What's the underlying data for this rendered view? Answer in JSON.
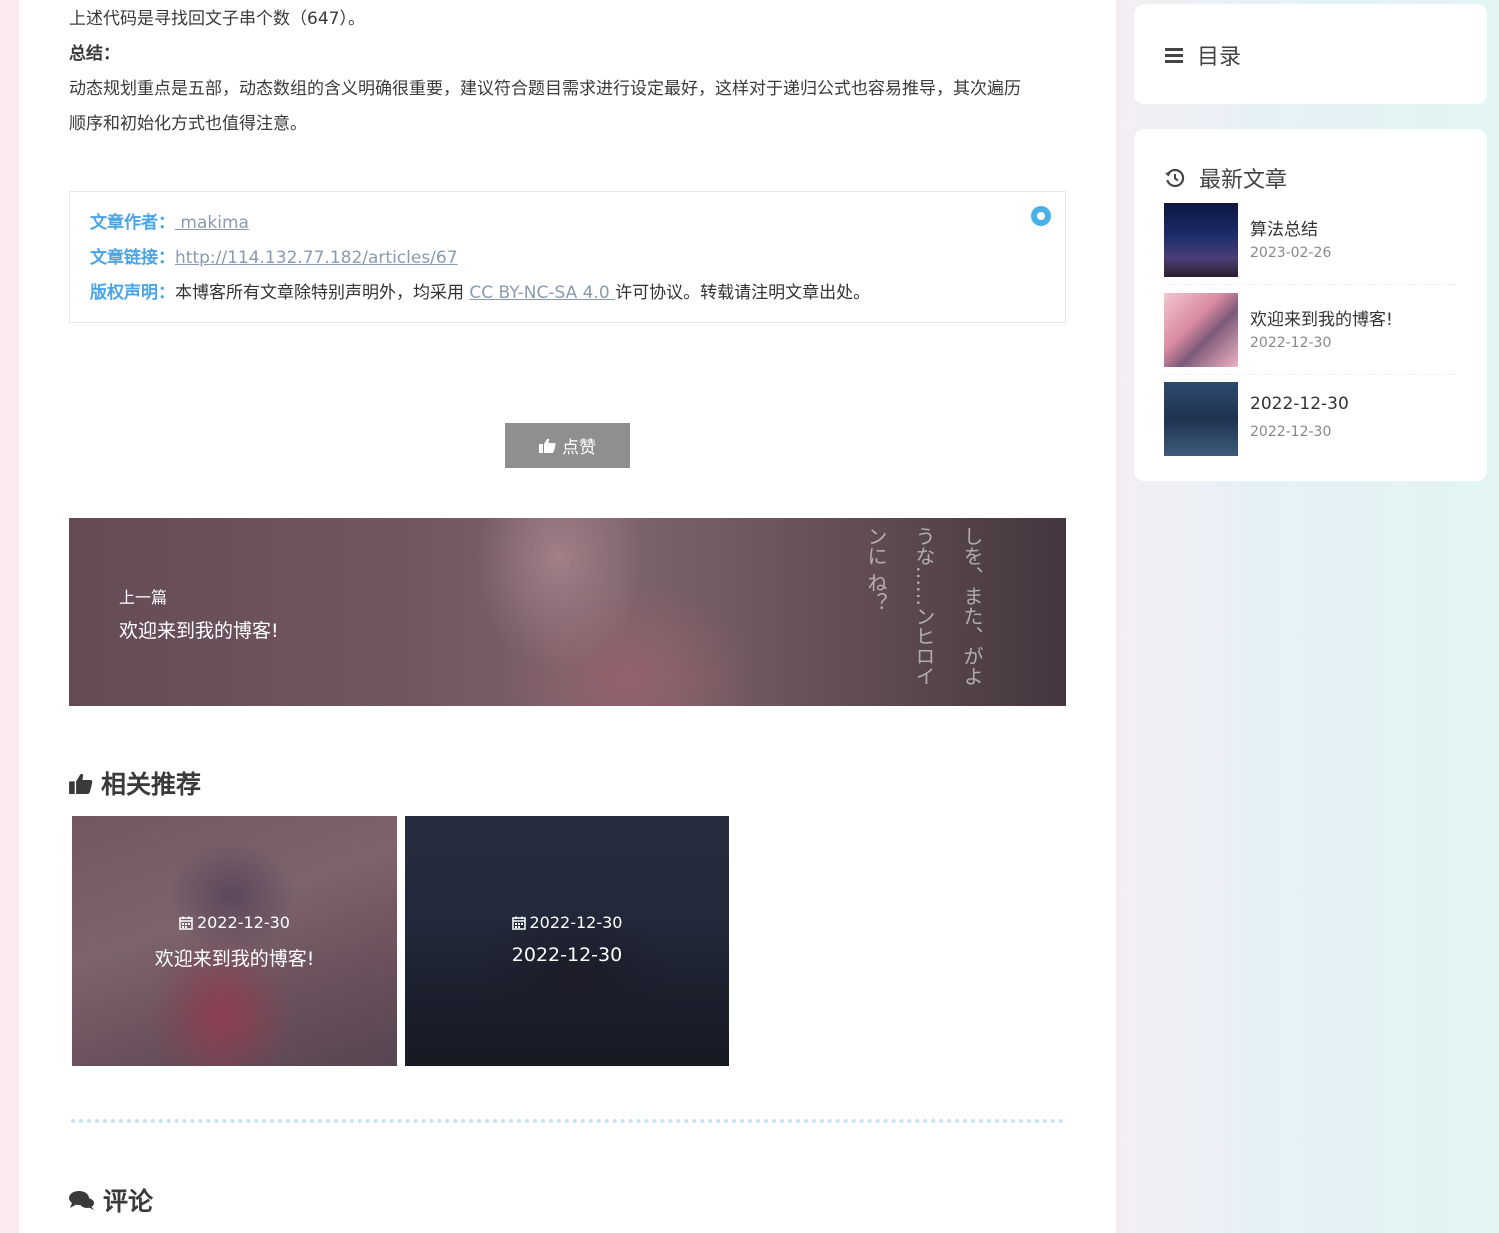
{
  "article": {
    "para1": "上述代码是寻找回文子串个数（647）。",
    "para2": "总结：",
    "para3_line1": "动态规划重点是五部，动态数组的含义明确很重要，建议符合题目需求进行设定最好，这样对于递归公式也容易推导，其次遍历",
    "para3_line2": "顺序和初始化方式也值得注意。"
  },
  "copyright": {
    "author_key": "文章作者：",
    "author_value": " makima",
    "link_key": "文章链接：",
    "link_value": "http://114.132.77.182/articles/67",
    "license_key": "版权声明：",
    "license_prefix": "本博客所有文章除特别声明外，均采用 ",
    "license_link": "CC BY-NC-SA 4.0 ",
    "license_suffix": "许可协议。转载请注明文章出处。"
  },
  "like_button": {
    "label": "点赞"
  },
  "prev_post": {
    "sub": "上一篇",
    "title": "欢迎来到我的博客!",
    "jp_text": "しを、また、がような……ンヒロインに ね？"
  },
  "related": {
    "heading": "相关推荐",
    "items": [
      {
        "date": "2022-12-30",
        "title": "欢迎来到我的博客!"
      },
      {
        "date": "2022-12-30",
        "title": "2022-12-30"
      }
    ]
  },
  "comments": {
    "heading": "评论"
  },
  "sidebar": {
    "toc_title": "目录",
    "latest_title": "最新文章",
    "latest": [
      {
        "title": "算法总结",
        "date": "2023-02-26"
      },
      {
        "title": "欢迎来到我的博客!",
        "date": "2022-12-30"
      },
      {
        "title": "2022-12-30",
        "date": "2022-12-30"
      }
    ]
  },
  "colors": {
    "accent": "#49a5e6",
    "like_bg": "#8f8f8f",
    "dot": "#49b1ea"
  }
}
